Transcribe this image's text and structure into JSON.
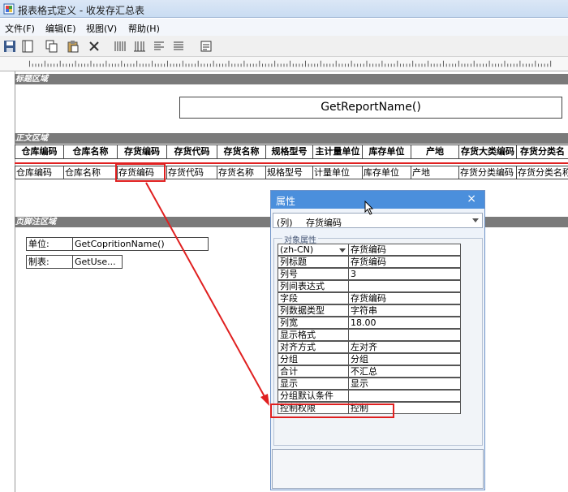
{
  "window": {
    "title": "报表格式定义 - 收发存汇总表"
  },
  "menu": [
    "文件(F)",
    "编辑(E)",
    "视图(V)",
    "帮助(H)"
  ],
  "bands": {
    "title": "标题区域",
    "body": "正文区域",
    "footer": "页脚注区域"
  },
  "report_title": "GetReportName()",
  "headers": [
    "仓库编码",
    "仓库名称",
    "存货编码",
    "存货代码",
    "存货名称",
    "规格型号",
    "主计量单位",
    "库存单位",
    "产地",
    "存货大类编码",
    "存货分类名"
  ],
  "data_fields": [
    "仓库编码",
    "仓库名称",
    "存货编码",
    "存货代码",
    "存货名称",
    "规格型号",
    "计量单位",
    "库存单位",
    "产地",
    "存货分类编码",
    "存货分类名称"
  ],
  "footer": {
    "unit_label": "单位:",
    "unit_value": "GetCopritionName()",
    "maker_label": "制表:",
    "maker_value": "GetUse..."
  },
  "props": {
    "title": "属性",
    "close": "×",
    "selector_type": "(列)",
    "selector_name": "存货编码",
    "group_label": "对象属性",
    "rows": [
      {
        "k": "(zh-CN)",
        "v": "存货编码"
      },
      {
        "k": "列标题",
        "v": "存货编码"
      },
      {
        "k": "列号",
        "v": "3"
      },
      {
        "k": "列间表达式",
        "v": ""
      },
      {
        "k": "字段",
        "v": "存货编码"
      },
      {
        "k": "列数据类型",
        "v": "字符串"
      },
      {
        "k": "列宽",
        "v": "18.00"
      },
      {
        "k": "显示格式",
        "v": ""
      },
      {
        "k": "对齐方式",
        "v": "左对齐"
      },
      {
        "k": "分组",
        "v": "分组"
      },
      {
        "k": "合计",
        "v": "不汇总"
      },
      {
        "k": "显示",
        "v": "显示"
      },
      {
        "k": "分组默认条件",
        "v": ""
      },
      {
        "k": "控制权限",
        "v": "控制"
      }
    ]
  },
  "colors": {
    "accent_red": "#e02020",
    "dialog_caption": "#4b8fdc"
  }
}
